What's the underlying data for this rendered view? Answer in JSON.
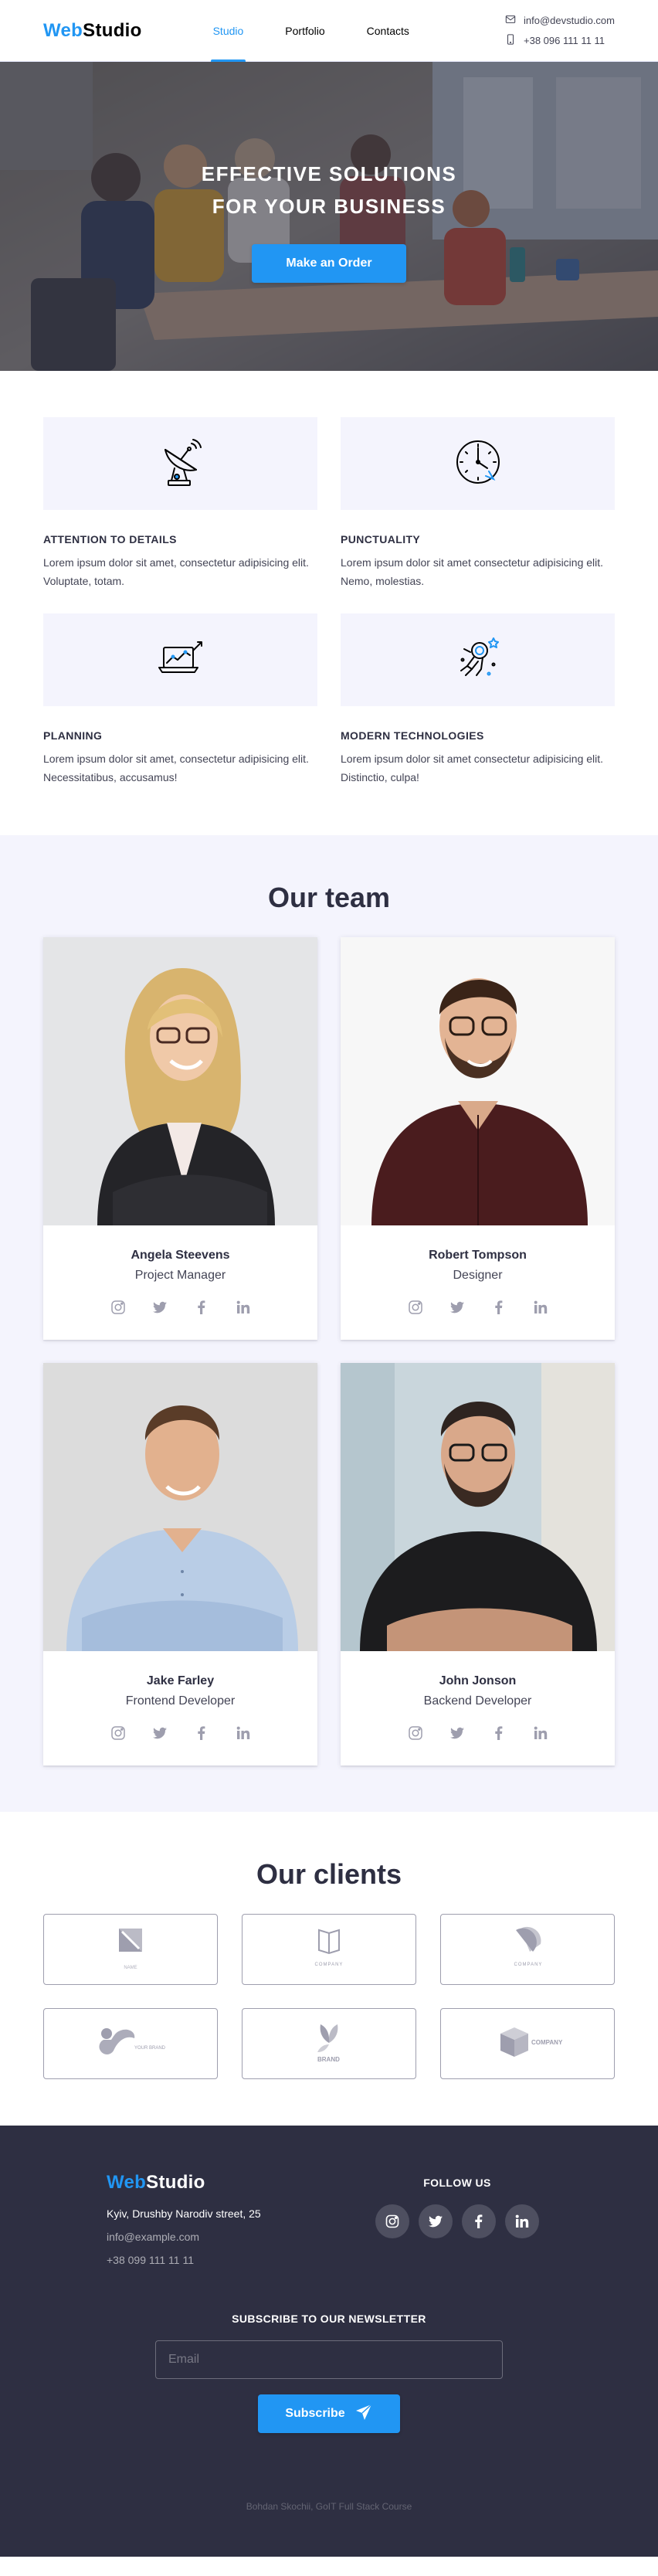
{
  "header": {
    "logo_accent": "Web",
    "logo_rest": "Studio",
    "nav": [
      {
        "label": "Studio",
        "active": true
      },
      {
        "label": "Portfolio",
        "active": false
      },
      {
        "label": "Contacts",
        "active": false
      }
    ],
    "email": "info@devstudio.com",
    "phone": "+38 096 111 11 11"
  },
  "hero": {
    "title": "EFFECTIVE SOLUTIONS FOR YOUR BUSINESS",
    "button_label": "Make an Order"
  },
  "features": [
    {
      "icon": "antenna-icon",
      "title": "ATTENTION TO DETAILS",
      "text": "Lorem ipsum dolor sit amet, consectetur adipisicing elit. Voluptate, totam."
    },
    {
      "icon": "clock-icon",
      "title": "PUNCTUALITY",
      "text": "Lorem ipsum dolor sit amet consectetur adipisicing elit. Nemo, molestias."
    },
    {
      "icon": "laptop-chart-icon",
      "title": "PLANNING",
      "text": "Lorem ipsum dolor sit amet, consectetur adipisicing elit. Necessitatibus, accusamus!"
    },
    {
      "icon": "astronaut-icon",
      "title": "MODERN TECHNOLOGIES",
      "text": "Lorem ipsum dolor sit amet consectetur adipisicing elit. Distinctio, culpa!"
    }
  ],
  "team": {
    "title": "Our team",
    "members": [
      {
        "name": "Angela Steevens",
        "role": "Project Manager"
      },
      {
        "name": "Robert Tompson",
        "role": "Designer"
      },
      {
        "name": "Jake Farley",
        "role": "Frontend Developer"
      },
      {
        "name": "John Jonson",
        "role": "Backend Developer"
      }
    ],
    "social_icons": [
      "instagram-icon",
      "twitter-icon",
      "facebook-icon",
      "linkedin-icon"
    ]
  },
  "clients": {
    "title": "Our clients",
    "logos": [
      "client-logo-1",
      "client-logo-2",
      "client-logo-3",
      "client-logo-4",
      "client-logo-5",
      "client-logo-6"
    ],
    "logo_texts": [
      "NAME",
      "COMPANY",
      "COMPANY",
      "YOUR BRAND",
      "BRAND",
      "COMPANY"
    ]
  },
  "footer": {
    "logo_accent": "Web",
    "logo_rest": "Studio",
    "address": "Kyiv, Drushby Narodiv street, 25",
    "email": "info@example.com",
    "phone": "+38 099 111 11 11",
    "follow_title": "FOLLOW US",
    "subscribe_title": "SUBSCRIBE TO OUR NEWSLETTER",
    "email_placeholder": "Email",
    "subscribe_label": "Subscribe",
    "credits": "Bohdan Skochii, GoIT Full Stack Course"
  },
  "colors": {
    "accent": "#2196f3",
    "dark": "#2e2f42",
    "light_bg": "#f4f4fd",
    "muted": "#9e9eae"
  }
}
